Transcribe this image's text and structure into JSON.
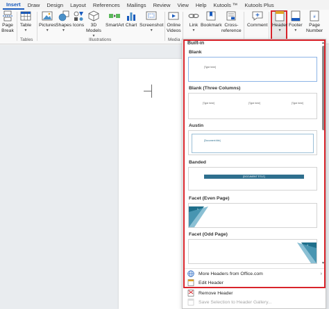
{
  "tabs": [
    "Insert",
    "Draw",
    "Design",
    "Layout",
    "References",
    "Mailings",
    "Review",
    "View",
    "Help",
    "Kutools ™",
    "Kutools Plus"
  ],
  "ribbon": {
    "page_break": [
      "Page",
      "Break"
    ],
    "table": "Table",
    "pictures": "Pictures",
    "shapes": "Shapes",
    "icons": "Icons",
    "models": [
      "3D",
      "Models"
    ],
    "smartart": "SmartArt",
    "chart": "Chart",
    "screenshot": "Screenshot",
    "online_videos": [
      "Online",
      "Videos"
    ],
    "link": "Link",
    "bookmark": "Bookmark",
    "cross_reference": [
      "Cross-",
      "reference"
    ],
    "comment": "Comment",
    "header": "Header",
    "footer": "Footer",
    "page_number": [
      "Page",
      "Number"
    ],
    "groups": {
      "tables": "Tables",
      "illustrations": "Illustrations",
      "media": "Media"
    }
  },
  "gallery": {
    "section": "Built-in",
    "items": [
      {
        "title": "Blank",
        "placeholder": "[Type here]"
      },
      {
        "title": "Blank (Three Columns)",
        "placeholders": [
          "[Type here]",
          "[Type here]",
          "[Type here]"
        ]
      },
      {
        "title": "Austin",
        "placeholder": "[Document title]"
      },
      {
        "title": "Banded",
        "placeholder": "[DOCUMENT TITLE]"
      },
      {
        "title": "Facet (Even Page)",
        "placeholder": "1"
      },
      {
        "title": "Facet (Odd Page)",
        "placeholder": "1"
      }
    ],
    "menu": {
      "more": "More Headers from Office.com",
      "edit": "Edit Header",
      "remove": "Remove Header",
      "save": "Save Selection to Header Gallery..."
    }
  },
  "colors": {
    "accent": "#185abd",
    "highlight": "#d8232a",
    "banded_bar": "#2e6f8e",
    "facet": "#1f6f8b"
  }
}
